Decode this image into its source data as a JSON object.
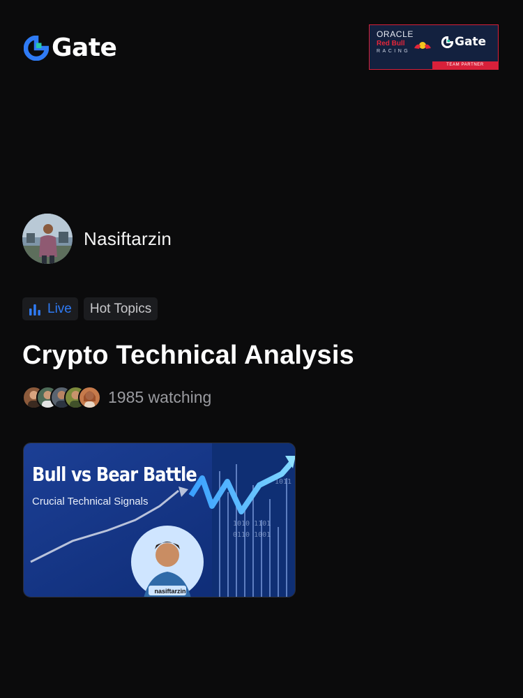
{
  "brand": {
    "logo_text": "Gate"
  },
  "partner_badge": {
    "oracle": "ORACLE",
    "redbull": "Red Bull",
    "racing": "RACING",
    "gate": "Gate",
    "partner_label": "TEAM PARTNER"
  },
  "author": {
    "name": "Nasiftarzin"
  },
  "tags": {
    "live": "Live",
    "hot": "Hot Topics"
  },
  "post": {
    "title": "Crypto Technical Analysis",
    "watching": "1985 watching"
  },
  "thumbnail": {
    "title": "Bull vs Bear Battle",
    "subtitle": "Crucial Technical Signals",
    "name": "nasiftarzin"
  },
  "colors": {
    "background": "#0b0b0c",
    "accent": "#2f7bf5",
    "brand_green": "#28c9a8",
    "badge_red": "#d8203a"
  }
}
